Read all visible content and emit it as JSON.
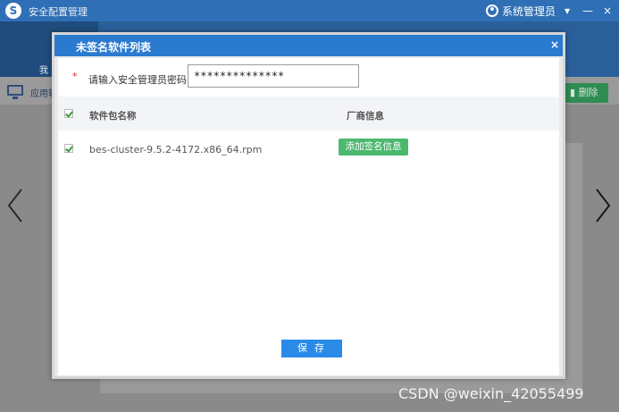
{
  "window": {
    "title": "安全配置管理",
    "user_name": "系统管理员",
    "logo_glyph": "S"
  },
  "background": {
    "nav_label": "我",
    "toolbar_app_label": "应用软",
    "delete_label": "删除"
  },
  "modal": {
    "title": "未签名软件列表",
    "close_label": "×",
    "password": {
      "required_mark": "*",
      "label": "请输入安全管理员密码：",
      "value": "**************"
    },
    "table": {
      "columns": [
        "软件包名称",
        "厂商信息"
      ],
      "rows": [
        {
          "checked": true,
          "package_name": "bes-cluster-9.5.2-4172.x86_64.rpm",
          "action_label": "添加签名信息"
        }
      ]
    },
    "save_label": "保存"
  },
  "watermark": "CSDN @weixin_42055499",
  "colors": {
    "titlebar": "#2f6fb5",
    "modal_header": "#2a7ad0",
    "save_button": "#2a8ae8",
    "sign_button": "#4cb86e",
    "delete_button": "#2f8c52"
  }
}
